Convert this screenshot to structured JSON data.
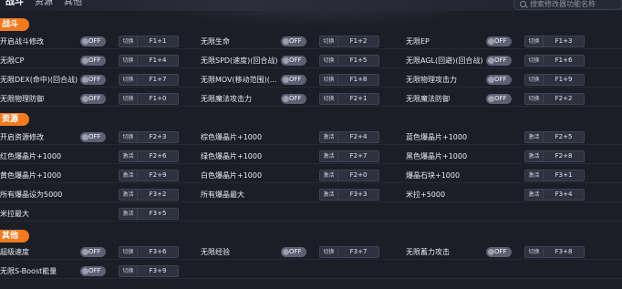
{
  "tabs": [
    "战斗",
    "资源",
    "其他"
  ],
  "search": {
    "placeholder": "搜索修改器功能名称"
  },
  "sections": [
    "战斗",
    "资源",
    "其他"
  ],
  "toggle_label": "OFF",
  "rows": {
    "battle": [
      [
        {
          "label": "开启战斗修改",
          "act": "切换",
          "key": "F1+1"
        },
        {
          "label": "无限生命",
          "act": "切换",
          "key": "F1+2"
        },
        {
          "label": "无限EP",
          "act": "切换",
          "key": "F1+3"
        }
      ],
      [
        {
          "label": "无限CP",
          "act": "切换",
          "key": "F1+4"
        },
        {
          "label": "无限SPD(速度)(回合战)",
          "act": "切换",
          "key": "F1+5"
        },
        {
          "label": "无限AGL(回避)(回合战)",
          "act": "切换",
          "key": "F1+6"
        }
      ],
      [
        {
          "label": "无限DEX(命中)(回合战)",
          "act": "切换",
          "key": "F1+7"
        },
        {
          "label": "无限MOV(移动范围)(...",
          "act": "切换",
          "key": "F1+8"
        },
        {
          "label": "无限物理攻击力",
          "act": "切换",
          "key": "F1+9"
        }
      ],
      [
        {
          "label": "无限物理防御",
          "act": "切换",
          "key": "F1+0"
        },
        {
          "label": "无限魔法攻击力",
          "act": "切换",
          "key": "F2+1"
        },
        {
          "label": "无限魔法防御",
          "act": "切换",
          "key": "F2+2"
        }
      ]
    ],
    "resource": [
      [
        {
          "label": "开启资源修改",
          "act": "切换",
          "key": "F2+3",
          "toggle": true
        },
        {
          "label": "棕色爆晶片+1000",
          "act": "激活",
          "key": "F2+4"
        },
        {
          "label": "蓝色爆晶片+1000",
          "act": "激活",
          "key": "F2+5"
        }
      ],
      [
        {
          "label": "红色爆晶片+1000",
          "act": "激活",
          "key": "F2+6"
        },
        {
          "label": "绿色爆晶片+1000",
          "act": "激活",
          "key": "F2+7"
        },
        {
          "label": "黑色爆晶片+1000",
          "act": "激活",
          "key": "F2+8"
        }
      ],
      [
        {
          "label": "黄色爆晶片+1000",
          "act": "激活",
          "key": "F2+9"
        },
        {
          "label": "白色爆晶片+1000",
          "act": "激活",
          "key": "F2+0"
        },
        {
          "label": "爆晶石块+1000",
          "act": "激活",
          "key": "F3+1"
        }
      ],
      [
        {
          "label": "所有爆晶设为5000",
          "act": "激活",
          "key": "F3+2"
        },
        {
          "label": "所有爆晶最大",
          "act": "激活",
          "key": "F3+3"
        },
        {
          "label": "米拉+5000",
          "act": "激活",
          "key": "F3+4"
        }
      ],
      [
        {
          "label": "米拉最大",
          "act": "激活",
          "key": "F3+5"
        }
      ]
    ],
    "other": [
      [
        {
          "label": "超级速度",
          "act": "切换",
          "key": "F3+6"
        },
        {
          "label": "无限经验",
          "act": "切换",
          "key": "F3+7"
        },
        {
          "label": "无限蓄力攻击",
          "act": "切换",
          "key": "F3+8"
        }
      ],
      [
        {
          "label": "无限S-Boost能量",
          "act": "切换",
          "key": "F3+9"
        }
      ]
    ]
  }
}
